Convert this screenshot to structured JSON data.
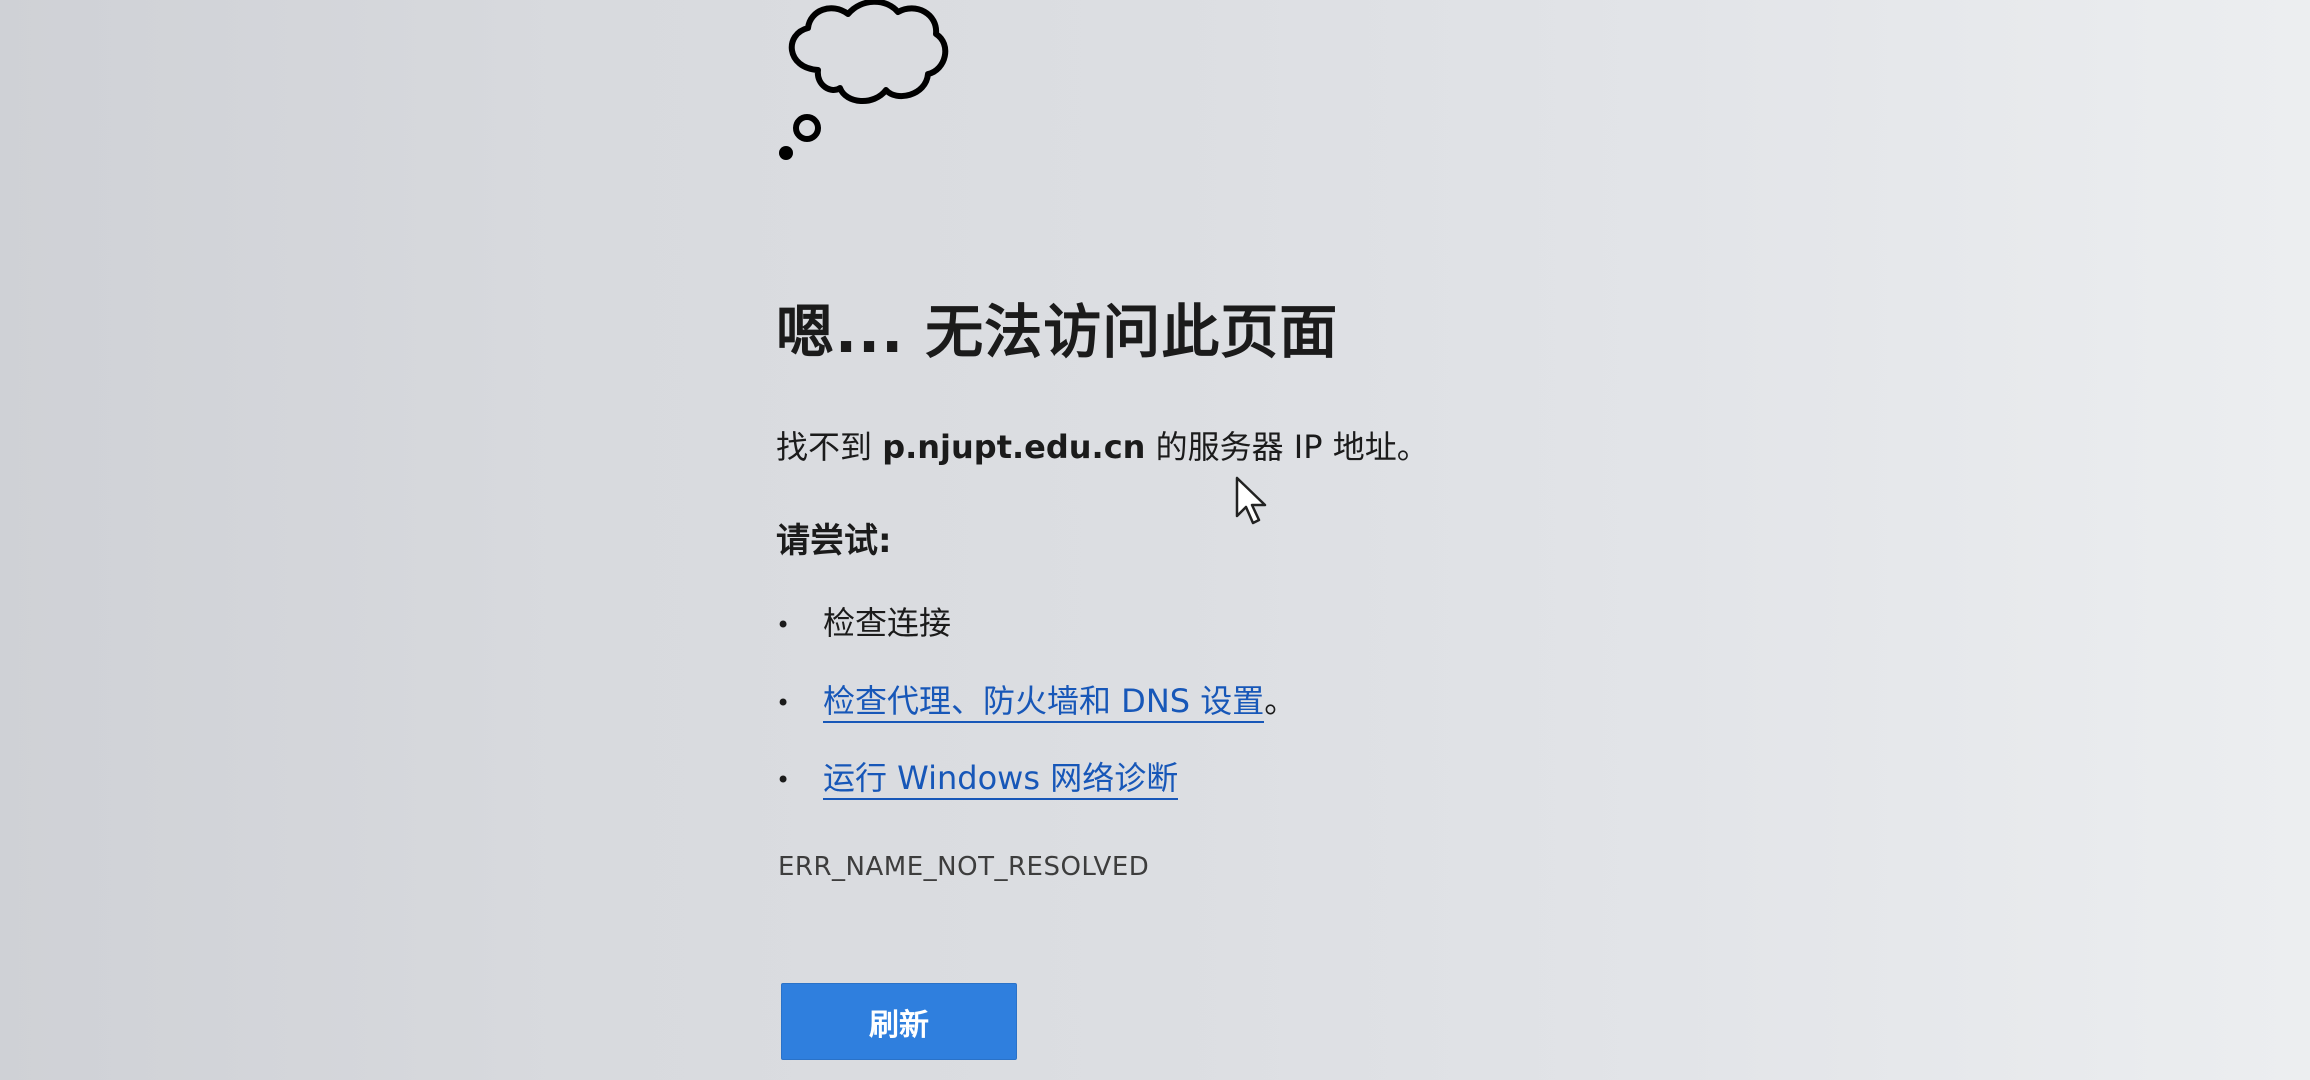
{
  "page": {
    "title": "嗯... 无法访问此页面",
    "message_prefix": "找不到 ",
    "host": "p.njupt.edu.cn",
    "message_suffix": " 的服务器 IP 地址。",
    "try_heading": "请尝试:",
    "suggestions": [
      {
        "text": "检查连接",
        "is_link": false,
        "trailing": ""
      },
      {
        "text": "检查代理、防火墙和 DNS 设置",
        "is_link": true,
        "trailing": "。"
      },
      {
        "text": "运行 Windows 网络诊断",
        "is_link": true,
        "trailing": ""
      }
    ],
    "bullet": "•",
    "error_code": "ERR_NAME_NOT_RESOLVED",
    "refresh_label": "刷新"
  },
  "icons": {
    "illustration": "thought-cloud-icon",
    "pointer": "mouse-cursor-icon"
  },
  "colors": {
    "link": "#1757b8",
    "button": "#2f7fde",
    "button_text": "#ffffff",
    "text": "#1b1b1b"
  }
}
